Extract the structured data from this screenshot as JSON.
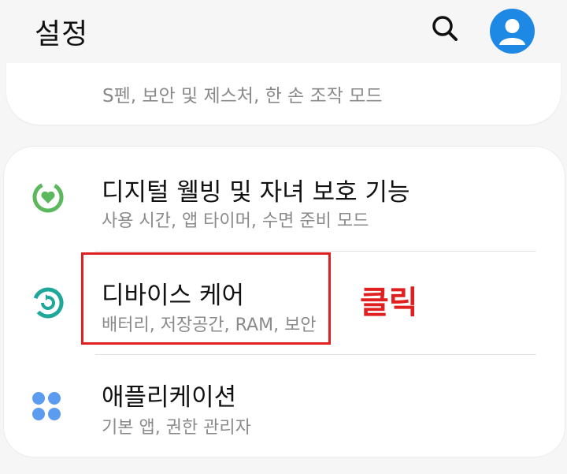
{
  "header": {
    "title": "설정"
  },
  "top_card": {
    "clipped_subtitle": "S펜, 보안 및 제스처, 한 손 조작 모드"
  },
  "settings_items": [
    {
      "label": "디지털 웰빙 및 자녀 보호 기능",
      "sub": "사용 시간, 앱 타이머, 수면 준비 모드",
      "icon": "digital-wellbeing-icon",
      "icon_color": "#5cb85c"
    },
    {
      "label": "디바이스 케어",
      "sub": "배터리, 저장공간, RAM, 보안",
      "icon": "device-care-icon",
      "icon_color": "#1fa89a"
    },
    {
      "label": "애플리케이션",
      "sub": "기본 앱, 권한 관리자",
      "icon": "apps-grid-icon",
      "icon_color": "#5b9bf0"
    }
  ],
  "annotation": {
    "text": "클릭",
    "color": "#e02020"
  },
  "colors": {
    "accent_blue": "#1e88e5",
    "background": "#f6f6f6"
  }
}
